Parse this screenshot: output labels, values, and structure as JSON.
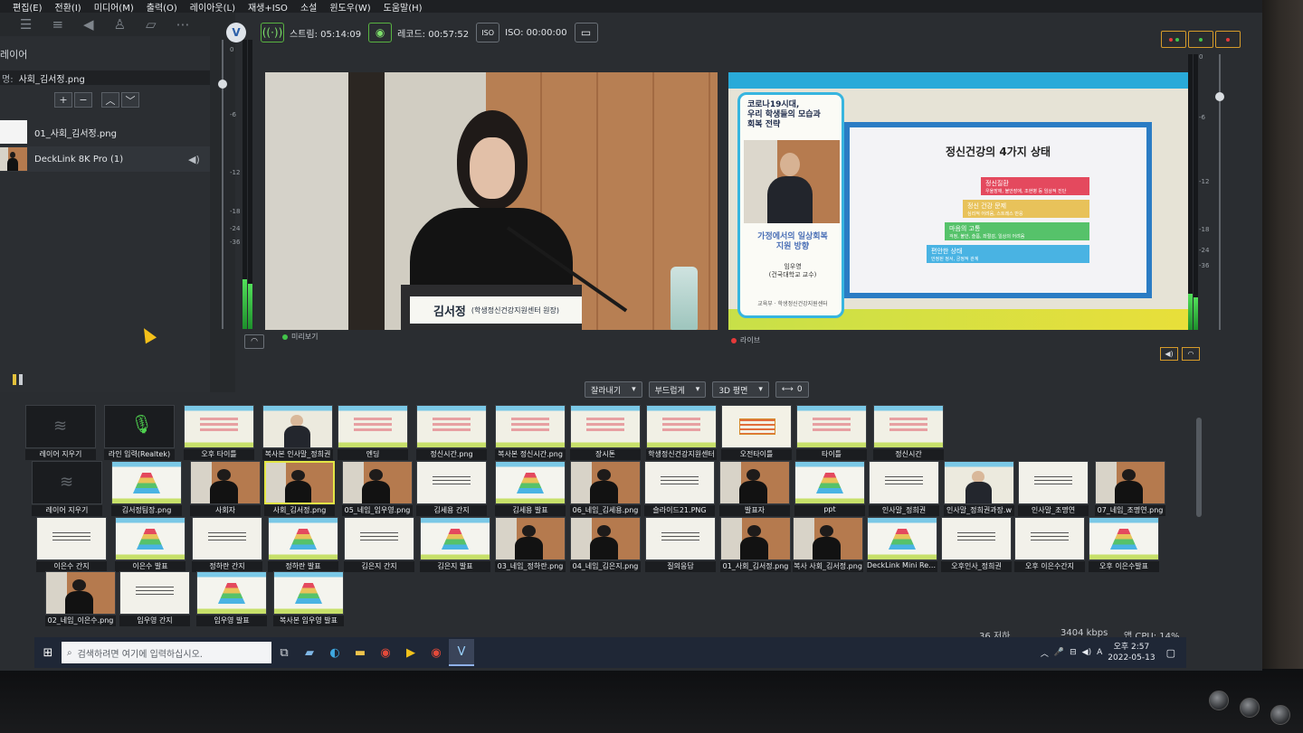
{
  "menu": [
    "편집(E)",
    "전환(I)",
    "미디어(M)",
    "출력(O)",
    "레이아웃(L)",
    "재생+ISO",
    "소설",
    "윈도우(W)",
    "도움말(H)"
  ],
  "left_panel": {
    "title": "레이어",
    "file_label": "명:",
    "file_value": "사회_김서정.png",
    "buttons": {
      "add": "+",
      "remove": "−",
      "up": "︿",
      "down": "﹀"
    },
    "layers": [
      "01_사회_김서정.png",
      "DeckLink 8K Pro (1)"
    ]
  },
  "meter_ticks": [
    "0",
    "-6",
    "-12",
    "-18",
    "-24",
    "-36"
  ],
  "topbar": {
    "stream_label": "스트림: 05:14:09",
    "record_label": "레코드: 00:57:52",
    "iso_label": "ISO: 00:00:00"
  },
  "preview": {
    "label": "미리보기",
    "lower_third_name": "김서정",
    "lower_third_title": "(학생정신건강지원센터 원장)"
  },
  "live": {
    "label": "라이브",
    "banner": "코로나19시대,\n우리 학생들의 모습과\n회복 전략",
    "session_title": "가정에서의 일상회복\n지원 방향",
    "speaker": "임우영\n(건국대학교 교수)",
    "org": "교육부 · 학생정신건강지원센터",
    "slide_heading": "정신건강의 4가지 상태",
    "pyramid": [
      {
        "label": "정신질환",
        "desc": "우울장애, 불안장애, 조현병 등 임상적 진단",
        "color": "#e4495e"
      },
      {
        "label": "정신 건강 문제",
        "desc": "심리적 어려움, 스트레스 반응",
        "color": "#e8c25a"
      },
      {
        "label": "마음의 고통",
        "desc": "걱정, 불안, 슬픔, 좌절감, 일상의 어려움",
        "color": "#56c26a"
      },
      {
        "label": "편안한 상태",
        "desc": "안정된 정서, 긍정적 관계",
        "color": "#49b3e3"
      }
    ]
  },
  "transitions": {
    "cut": "잘라내기",
    "fade": "부드럽게",
    "flip": "3D 평면",
    "speed": "0"
  },
  "tiles_row1": [
    {
      "cap": "레이어 지우기",
      "shape": "dark"
    },
    {
      "cap": "라인 입력(Realtek)",
      "shape": "mic"
    },
    {
      "cap": "오후 타이틀",
      "shape": "slide"
    },
    {
      "cap": "복사본 인사말_정희권",
      "shape": "man"
    },
    {
      "cap": "엔딩",
      "shape": "slide"
    },
    {
      "cap": "정신시간.png",
      "shape": "slide"
    },
    {
      "cap": "복사본 정신시간.png",
      "shape": "slide"
    },
    {
      "cap": "장시톤",
      "shape": "slide"
    },
    {
      "cap": "학생정신건강지원센터",
      "shape": "slide"
    },
    {
      "cap": "오전타이틀",
      "shape": "title"
    },
    {
      "cap": "타이틀",
      "shape": "slide"
    },
    {
      "cap": "정신시간",
      "shape": "slide"
    }
  ],
  "tiles_row2": [
    {
      "cap": "레이어 지우기",
      "shape": "dark"
    },
    {
      "cap": "김서정팀장.png",
      "shape": "pyr"
    },
    {
      "cap": "사회자",
      "shape": "person"
    },
    {
      "cap": "사회_김서정.png",
      "shape": "person"
    },
    {
      "cap": "05_네임_임우영.png",
      "shape": "person"
    },
    {
      "cap": "김세용 간지",
      "shape": "white"
    },
    {
      "cap": "김세용 발표",
      "shape": "pyr"
    },
    {
      "cap": "06_네임_김세용.png",
      "shape": "person"
    },
    {
      "cap": "슬라이드21.PNG",
      "shape": "white"
    },
    {
      "cap": "발표자",
      "shape": "person"
    },
    {
      "cap": "ppt",
      "shape": "pyr"
    },
    {
      "cap": "인사말_정희권",
      "shape": "white"
    },
    {
      "cap": "인사말_정희권과장.w",
      "shape": "man"
    },
    {
      "cap": "인사말_조명연",
      "shape": "white"
    },
    {
      "cap": "07_네임_조명연.png",
      "shape": "person"
    }
  ],
  "tiles_row3": [
    {
      "cap": "이은수 간지",
      "shape": "white"
    },
    {
      "cap": "이은수 발표",
      "shape": "pyr"
    },
    {
      "cap": "정하란 간지",
      "shape": "white"
    },
    {
      "cap": "정하란 발표",
      "shape": "pyr"
    },
    {
      "cap": "김은지 간지",
      "shape": "white"
    },
    {
      "cap": "김은지 발표",
      "shape": "pyr"
    },
    {
      "cap": "03_네임_정하란.png",
      "shape": "person"
    },
    {
      "cap": "04_네임_김은지.png",
      "shape": "person"
    },
    {
      "cap": "질의응답",
      "shape": "white"
    },
    {
      "cap": "01_사회_김서정.png",
      "shape": "person"
    },
    {
      "cap": "복사 사회_김서정.png",
      "shape": "person"
    },
    {
      "cap": "DeckLink Mini Record",
      "shape": "pyr"
    },
    {
      "cap": "오후인사_정희권",
      "shape": "white"
    },
    {
      "cap": "오후 이은수간지",
      "shape": "white"
    },
    {
      "cap": "오후 이은수발표",
      "shape": "pyr"
    }
  ],
  "tiles_row4": [
    {
      "cap": "02_네임_이은수.png",
      "shape": "person"
    },
    {
      "cap": "임우영 간지",
      "shape": "white"
    },
    {
      "cap": "임우영 발표",
      "shape": "pyr"
    },
    {
      "cap": "복사본 임우영 발표",
      "shape": "pyr"
    }
  ],
  "status": {
    "fps": "36 저하",
    "bitrate": "3404 kbps",
    "cpu": "앱 CPU: 14%"
  },
  "taskbar": {
    "search_placeholder": "검색하려면 여기에 입력하십시오.",
    "time": "오후 2:57",
    "date": "2022-05-13"
  },
  "colors": {
    "accent_green": "#58b341",
    "live_dot": "#e53a3a",
    "preview_dot": "#43c34a",
    "selection": "#e3e645"
  }
}
